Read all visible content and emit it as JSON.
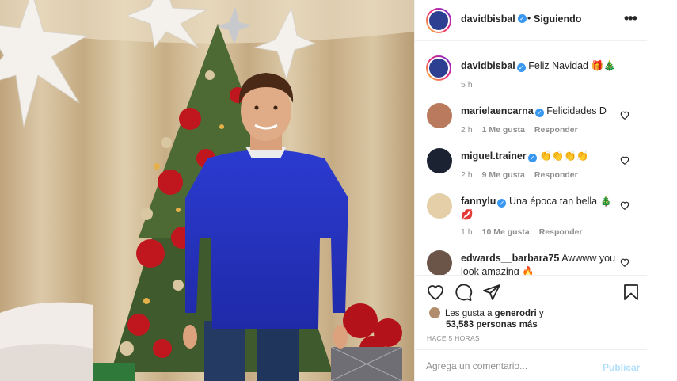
{
  "post": {
    "author": "davidbisbal",
    "follow_status": "Siguiendo",
    "separator": "•",
    "more_icon": "more-horizontal-icon",
    "caption": "Feliz Navidad 🎁🎄",
    "caption_time": "5 h"
  },
  "comments": [
    {
      "user": "marielaencarna",
      "verified": true,
      "text": "Felicidades D",
      "time": "2 h",
      "likes": "1 Me gusta",
      "reply": "Responder"
    },
    {
      "user": "miguel.trainer",
      "verified": true,
      "text": "👏👏👏👏",
      "time": "2 h",
      "likes": "9 Me gusta",
      "reply": "Responder"
    },
    {
      "user": "fannylu",
      "verified": true,
      "text": "Una época tan bella 🎄 💋",
      "time": "1 h",
      "likes": "10 Me gusta",
      "reply": "Responder"
    },
    {
      "user": "edwards__barbara75",
      "verified": false,
      "text": "Awwww you look amazing 🔥",
      "time": "",
      "likes": "",
      "reply": ""
    }
  ],
  "likes": {
    "prefix": "Les gusta a",
    "user": "generodri",
    "conj": "y",
    "count": "53,583 personas más"
  },
  "timestamp": "Hace 5 horas",
  "add_comment": {
    "placeholder": "Agrega un comentario...",
    "post_label": "Publicar"
  },
  "icons": {
    "like": "heart-icon",
    "comment": "comment-icon",
    "share": "send-icon",
    "save": "bookmark-icon",
    "verified": "verified-badge-icon"
  },
  "colors": {
    "accent": "#3897f0",
    "muted": "#8e8e8e",
    "publish_disabled": "#b2dffc"
  }
}
